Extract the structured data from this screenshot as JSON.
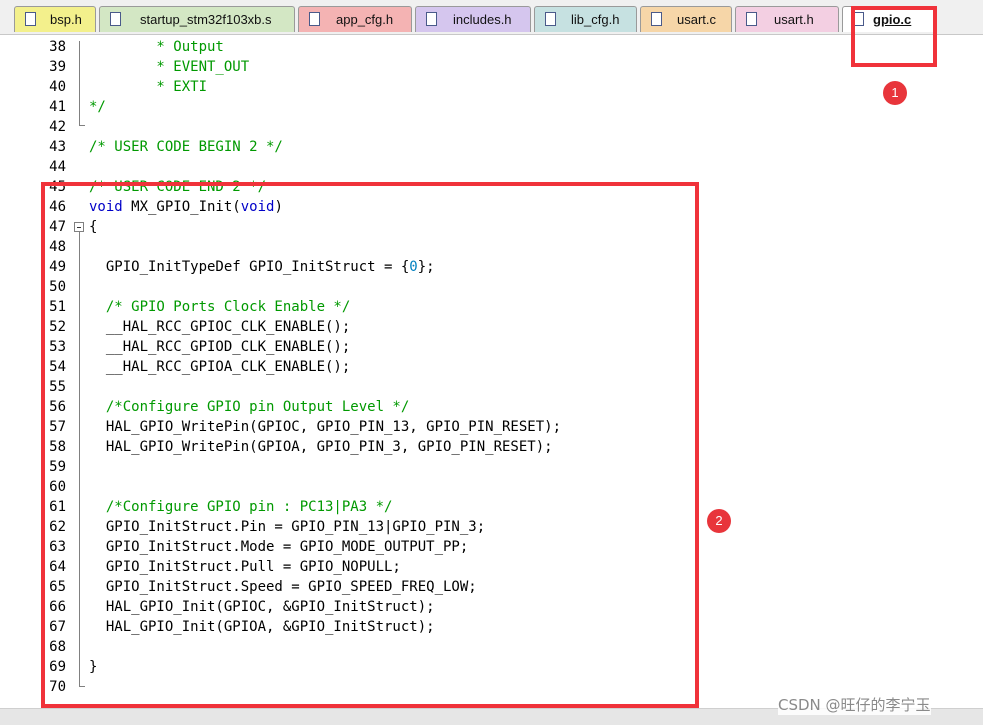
{
  "tabs": [
    {
      "label": "bsp.h",
      "color": "#f3f08c"
    },
    {
      "label": "startup_stm32f103xb.s",
      "color": "#d3e7c4"
    },
    {
      "label": "app_cfg.h",
      "color": "#f4b3b3"
    },
    {
      "label": "includes.h",
      "color": "#d5c6ee"
    },
    {
      "label": "lib_cfg.h",
      "color": "#c6e1e1"
    },
    {
      "label": "usart.c",
      "color": "#f6d6a8"
    },
    {
      "label": "usart.h",
      "color": "#f3cfe2"
    },
    {
      "label": "gpio.c",
      "color": "#ffffff",
      "active": true
    }
  ],
  "editor": {
    "lines": [
      {
        "n": "38",
        "text": "        * Output"
      },
      {
        "n": "39",
        "text": "        * EVENT_OUT"
      },
      {
        "n": "40",
        "text": "        * EXTI"
      },
      {
        "n": "41",
        "text": "*/"
      },
      {
        "n": "42",
        "text": ""
      },
      {
        "n": "43",
        "text": "/* USER CODE BEGIN 2 */"
      },
      {
        "n": "44",
        "text": ""
      },
      {
        "n": "45",
        "text": "/* USER CODE END 2 */"
      },
      {
        "n": "46",
        "text": "void MX_GPIO_Init(void)"
      },
      {
        "n": "47",
        "text": "{"
      },
      {
        "n": "48",
        "text": ""
      },
      {
        "n": "49",
        "text": "  GPIO_InitTypeDef GPIO_InitStruct = {0};"
      },
      {
        "n": "50",
        "text": ""
      },
      {
        "n": "51",
        "text": "  /* GPIO Ports Clock Enable */"
      },
      {
        "n": "52",
        "text": "  __HAL_RCC_GPIOC_CLK_ENABLE();"
      },
      {
        "n": "53",
        "text": "  __HAL_RCC_GPIOD_CLK_ENABLE();"
      },
      {
        "n": "54",
        "text": "  __HAL_RCC_GPIOA_CLK_ENABLE();"
      },
      {
        "n": "55",
        "text": ""
      },
      {
        "n": "56",
        "text": "  /*Configure GPIO pin Output Level */"
      },
      {
        "n": "57",
        "text": "  HAL_GPIO_WritePin(GPIOC, GPIO_PIN_13, GPIO_PIN_RESET);"
      },
      {
        "n": "58",
        "text": "  HAL_GPIO_WritePin(GPIOA, GPIO_PIN_3, GPIO_PIN_RESET);"
      },
      {
        "n": "59",
        "text": ""
      },
      {
        "n": "60",
        "text": ""
      },
      {
        "n": "61",
        "text": "  /*Configure GPIO pin : PC13|PA3 */"
      },
      {
        "n": "62",
        "text": "  GPIO_InitStruct.Pin = GPIO_PIN_13|GPIO_PIN_3;"
      },
      {
        "n": "63",
        "text": "  GPIO_InitStruct.Mode = GPIO_MODE_OUTPUT_PP;"
      },
      {
        "n": "64",
        "text": "  GPIO_InitStruct.Pull = GPIO_NOPULL;"
      },
      {
        "n": "65",
        "text": "  GPIO_InitStruct.Speed = GPIO_SPEED_FREQ_LOW;"
      },
      {
        "n": "66",
        "text": "  HAL_GPIO_Init(GPIOC, &GPIO_InitStruct);"
      },
      {
        "n": "67",
        "text": "  HAL_GPIO_Init(GPIOA, &GPIO_InitStruct);"
      },
      {
        "n": "68",
        "text": ""
      },
      {
        "n": "69",
        "text": "}"
      },
      {
        "n": "70",
        "text": ""
      }
    ]
  },
  "annotations": {
    "badge_1": "1",
    "badge_2": "2",
    "color": "#f0323a"
  },
  "watermark": "CSDN @旺仔的李宁玉"
}
